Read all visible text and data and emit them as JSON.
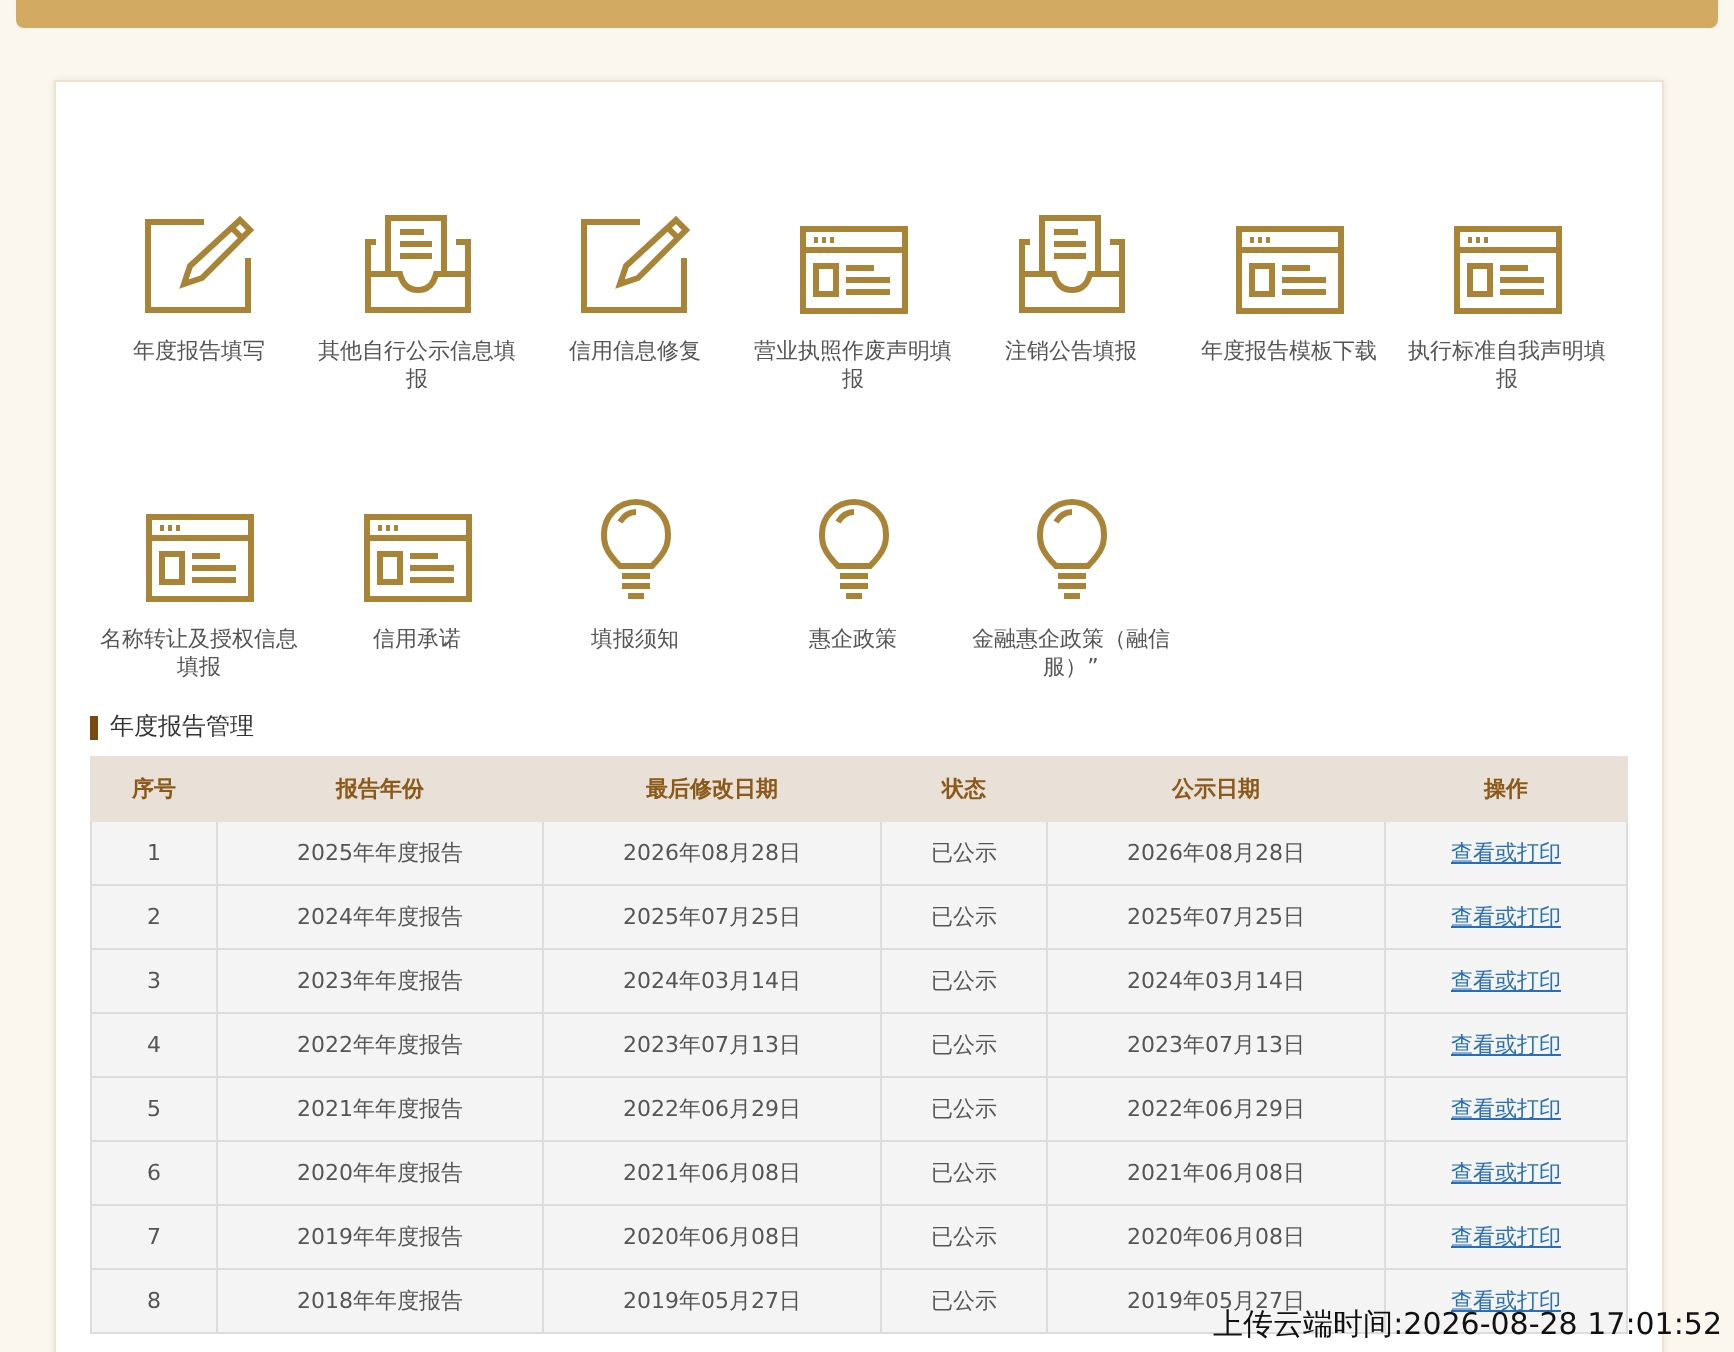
{
  "shortcuts": [
    {
      "label": "年度报告填写",
      "kind": "pencil"
    },
    {
      "label": "其他自行公示信息填报",
      "kind": "tray"
    },
    {
      "label": "信用信息修复",
      "kind": "pencil"
    },
    {
      "label": "营业执照作废声明填报",
      "kind": "window"
    },
    {
      "label": "注销公告填报",
      "kind": "tray"
    },
    {
      "label": "年度报告模板下载",
      "kind": "window"
    },
    {
      "label": "执行标准自我声明填报",
      "kind": "window"
    },
    {
      "label": "名称转让及授权信息填报",
      "kind": "window"
    },
    {
      "label": "信用承诺",
      "kind": "window"
    },
    {
      "label": "填报须知",
      "kind": "bulb"
    },
    {
      "label": "惠企政策",
      "kind": "bulb"
    },
    {
      "label": "金融惠企政策（融信服）”",
      "kind": "bulb"
    }
  ],
  "section_title": "年度报告管理",
  "table": {
    "columns": [
      "序号",
      "报告年份",
      "最后修改日期",
      "状态",
      "公示日期",
      "操作"
    ],
    "rows": [
      [
        "1",
        "2025年年度报告",
        "2026年08月28日",
        "已公示",
        "2026年08月28日",
        "查看或打印"
      ],
      [
        "2",
        "2024年年度报告",
        "2025年07月25日",
        "已公示",
        "2025年07月25日",
        "查看或打印"
      ],
      [
        "3",
        "2023年年度报告",
        "2024年03月14日",
        "已公示",
        "2024年03月14日",
        "查看或打印"
      ],
      [
        "4",
        "2022年年度报告",
        "2023年07月13日",
        "已公示",
        "2023年07月13日",
        "查看或打印"
      ],
      [
        "5",
        "2021年年度报告",
        "2022年06月29日",
        "已公示",
        "2022年06月29日",
        "查看或打印"
      ],
      [
        "6",
        "2020年年度报告",
        "2021年06月08日",
        "已公示",
        "2021年06月08日",
        "查看或打印"
      ],
      [
        "7",
        "2019年年度报告",
        "2020年06月08日",
        "已公示",
        "2020年06月08日",
        "查看或打印"
      ],
      [
        "8",
        "2018年年度报告",
        "2019年05月27日",
        "已公示",
        "2019年05月27日",
        "查看或打印"
      ]
    ]
  },
  "timestamp": "上传云端时间:2026-08-28 17:01:52"
}
